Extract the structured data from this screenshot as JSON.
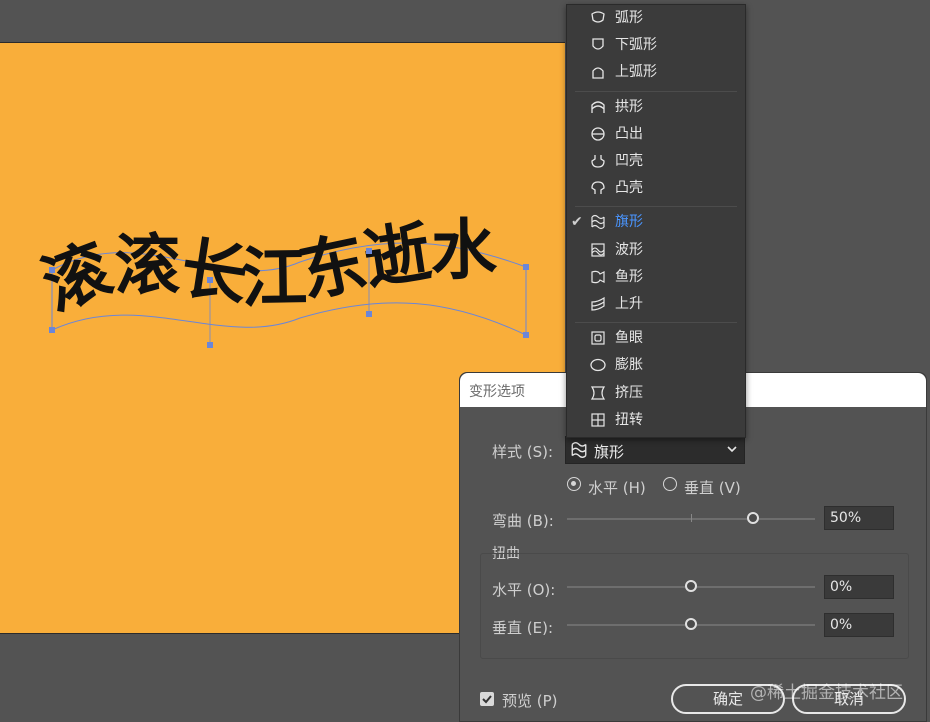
{
  "artwork": {
    "text": "滚滚长江东逝水",
    "fill": "#111111",
    "artboard_color": "#f9ae3a",
    "selection_color": "#6b86d8"
  },
  "dropdown": {
    "items": [
      {
        "label": "弧形",
        "icon": "arc-icon"
      },
      {
        "label": "下弧形",
        "icon": "arc-lower-icon"
      },
      {
        "label": "上弧形",
        "icon": "arc-upper-icon"
      },
      {
        "label": "拱形",
        "icon": "arch-icon"
      },
      {
        "label": "凸出",
        "icon": "bulge-icon"
      },
      {
        "label": "凹壳",
        "icon": "shell-lower-icon"
      },
      {
        "label": "凸壳",
        "icon": "shell-upper-icon"
      },
      {
        "label": "旗形",
        "icon": "flag-icon",
        "checked": true
      },
      {
        "label": "波形",
        "icon": "wave-icon"
      },
      {
        "label": "鱼形",
        "icon": "fish-icon"
      },
      {
        "label": "上升",
        "icon": "rise-icon"
      },
      {
        "label": "鱼眼",
        "icon": "fisheye-icon"
      },
      {
        "label": "膨胀",
        "icon": "inflate-icon"
      },
      {
        "label": "挤压",
        "icon": "squeeze-icon"
      },
      {
        "label": "扭转",
        "icon": "twist-icon"
      }
    ],
    "checked_color": "#4a95ff"
  },
  "dialog": {
    "title": "变形选项",
    "style_label": "样式 (S):",
    "style_value": "旗形",
    "orientation": {
      "horizontal_label": "水平 (H)",
      "vertical_label": "垂直 (V)",
      "selected": "horizontal"
    },
    "bend": {
      "label": "弯曲 (B):",
      "value": "50%",
      "fraction": 0.75
    },
    "distortion": {
      "group_label": "扭曲",
      "horizontal": {
        "label": "水平 (O):",
        "value": "0%",
        "fraction": 0.5
      },
      "vertical": {
        "label": "垂直 (E):",
        "value": "0%",
        "fraction": 0.5
      }
    },
    "preview": {
      "label": "预览 (P)",
      "checked": true
    },
    "ok_label": "确定",
    "cancel_label": "取消"
  },
  "watermark": "@稀土掘金技术社区"
}
